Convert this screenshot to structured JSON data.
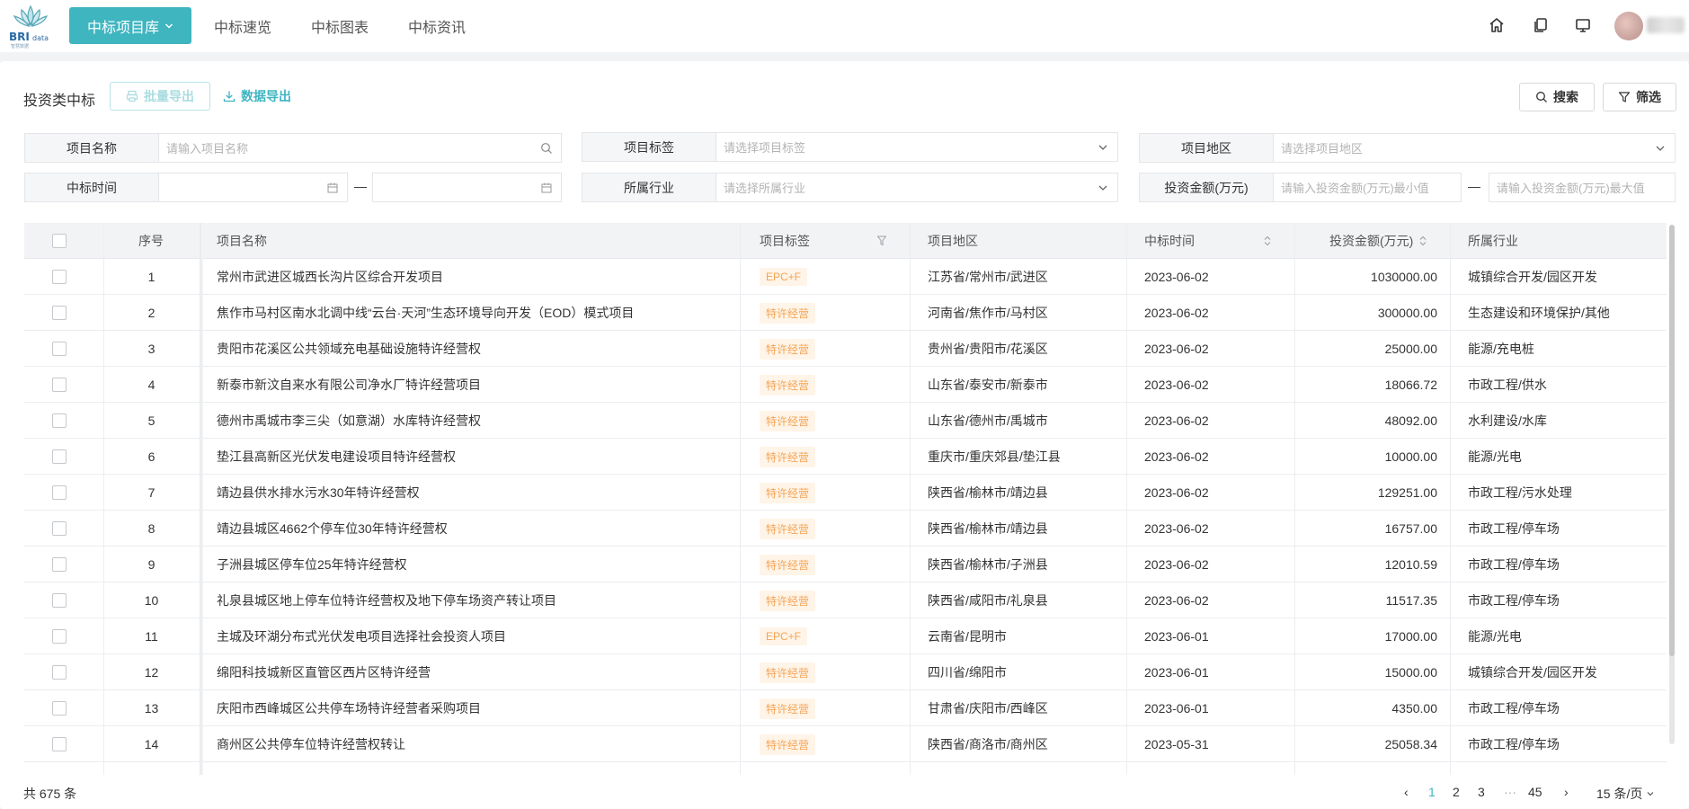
{
  "brand": {
    "logo_text": "BRIdata",
    "logo_subtext": "智慧数据"
  },
  "nav": {
    "active": "中标项目库",
    "items": [
      "中标速览",
      "中标图表",
      "中标资讯"
    ]
  },
  "top_icons": [
    "home-icon",
    "copy-icon",
    "monitor-icon"
  ],
  "toolbar": {
    "title": "投资类中标",
    "batch_export": "批量导出",
    "data_export": "数据导出",
    "search": "搜索",
    "filter": "筛选"
  },
  "filters": {
    "project_name": {
      "label": "项目名称",
      "placeholder": "请输入项目名称"
    },
    "project_tag": {
      "label": "项目标签",
      "placeholder": "请选择项目标签"
    },
    "project_region": {
      "label": "项目地区",
      "placeholder": "请选择项目地区"
    },
    "bid_time": {
      "label": "中标时间",
      "start": "",
      "end": "",
      "separator": "—"
    },
    "industry": {
      "label": "所属行业",
      "placeholder": "请选择所属行业"
    },
    "investment": {
      "label": "投资金额(万元)",
      "min_placeholder": "请输入投资金额(万元)最小值",
      "max_placeholder": "请输入投资金额(万元)最大值",
      "separator": "—"
    }
  },
  "table": {
    "columns": [
      "序号",
      "项目名称",
      "项目标签",
      "项目地区",
      "中标时间",
      "投资金额(万元)",
      "所属行业"
    ],
    "rows": [
      {
        "no": "1",
        "name": "常州市武进区城西长沟片区综合开发项目",
        "tag": "EPC+F",
        "region": "江苏省/常州市/武进区",
        "date": "2023-06-02",
        "amount": "1030000.00",
        "industry": "城镇综合开发/园区开发"
      },
      {
        "no": "2",
        "name": "焦作市马村区南水北调中线“云台·天河”生态环境导向开发（EOD）模式项目",
        "tag": "特许经营",
        "region": "河南省/焦作市/马村区",
        "date": "2023-06-02",
        "amount": "300000.00",
        "industry": "生态建设和环境保护/其他"
      },
      {
        "no": "3",
        "name": "贵阳市花溪区公共领域充电基础设施特许经营权",
        "tag": "特许经营",
        "region": "贵州省/贵阳市/花溪区",
        "date": "2023-06-02",
        "amount": "25000.00",
        "industry": "能源/充电桩"
      },
      {
        "no": "4",
        "name": "新泰市新汶自来水有限公司净水厂特许经营项目",
        "tag": "特许经营",
        "region": "山东省/泰安市/新泰市",
        "date": "2023-06-02",
        "amount": "18066.72",
        "industry": "市政工程/供水"
      },
      {
        "no": "5",
        "name": "德州市禹城市李三尖（如意湖）水库特许经营权",
        "tag": "特许经营",
        "region": "山东省/德州市/禹城市",
        "date": "2023-06-02",
        "amount": "48092.00",
        "industry": "水利建设/水库"
      },
      {
        "no": "6",
        "name": "垫江县高新区光伏发电建设项目特许经营权",
        "tag": "特许经营",
        "region": "重庆市/重庆郊县/垫江县",
        "date": "2023-06-02",
        "amount": "10000.00",
        "industry": "能源/光电"
      },
      {
        "no": "7",
        "name": "靖边县供水排水污水30年特许经营权",
        "tag": "特许经营",
        "region": "陕西省/榆林市/靖边县",
        "date": "2023-06-02",
        "amount": "129251.00",
        "industry": "市政工程/污水处理"
      },
      {
        "no": "8",
        "name": "靖边县城区4662个停车位30年特许经营权",
        "tag": "特许经营",
        "region": "陕西省/榆林市/靖边县",
        "date": "2023-06-02",
        "amount": "16757.00",
        "industry": "市政工程/停车场"
      },
      {
        "no": "9",
        "name": "子洲县城区停车位25年特许经营权",
        "tag": "特许经营",
        "region": "陕西省/榆林市/子洲县",
        "date": "2023-06-02",
        "amount": "12010.59",
        "industry": "市政工程/停车场"
      },
      {
        "no": "10",
        "name": "礼泉县城区地上停车位特许经营权及地下停车场资产转让项目",
        "tag": "特许经营",
        "region": "陕西省/咸阳市/礼泉县",
        "date": "2023-06-02",
        "amount": "11517.35",
        "industry": "市政工程/停车场"
      },
      {
        "no": "11",
        "name": "主城及环湖分布式光伏发电项目选择社会投资人项目",
        "tag": "EPC+F",
        "region": "云南省/昆明市",
        "date": "2023-06-01",
        "amount": "17000.00",
        "industry": "能源/光电"
      },
      {
        "no": "12",
        "name": "绵阳科技城新区直管区西片区特许经营",
        "tag": "特许经营",
        "region": "四川省/绵阳市",
        "date": "2023-06-01",
        "amount": "15000.00",
        "industry": "城镇综合开发/园区开发"
      },
      {
        "no": "13",
        "name": "庆阳市西峰城区公共停车场特许经营者采购项目",
        "tag": "特许经营",
        "region": "甘肃省/庆阳市/西峰区",
        "date": "2023-06-01",
        "amount": "4350.00",
        "industry": "市政工程/停车场"
      },
      {
        "no": "14",
        "name": "商州区公共停车位特许经营权转让",
        "tag": "特许经营",
        "region": "陕西省/商洛市/商州区",
        "date": "2023-05-31",
        "amount": "25058.34",
        "industry": "市政工程/停车场"
      }
    ]
  },
  "pagination": {
    "total": "共 675 条",
    "pages": [
      "1",
      "2",
      "3",
      "···",
      "45"
    ],
    "current": "1",
    "page_size": "15 条/页"
  },
  "colors": {
    "accent": "#3fb5c0",
    "tag_bg": "#fff4e8",
    "tag_text": "#f5a454"
  }
}
